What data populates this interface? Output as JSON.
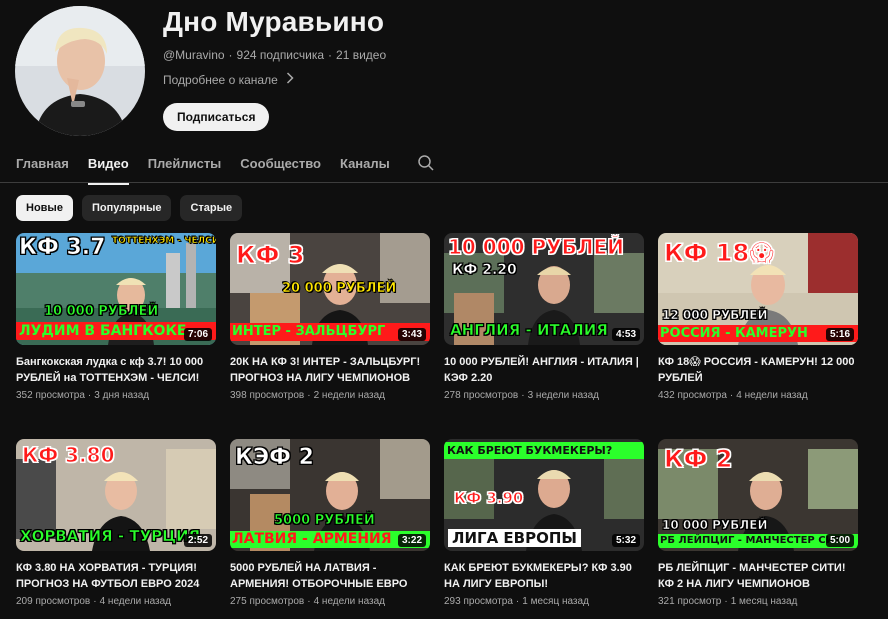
{
  "channel": {
    "name": "Дно Муравьино",
    "handle": "@Muravino",
    "subscribers": "924 подписчика",
    "videos_count": "21 видео",
    "more_about": "Подробнее о канале",
    "subscribe_label": "Подписаться"
  },
  "tabs": [
    "Главная",
    "Видео",
    "Плейлисты",
    "Сообщество",
    "Каналы"
  ],
  "active_tab": "Видео",
  "filters": [
    "Новые",
    "Популярные",
    "Старые"
  ],
  "active_filter": "Новые",
  "colors": {
    "background": "#0f0f0f",
    "text": "#f1f1f1",
    "secondary_text": "#aaaaaa",
    "chip": "#272727"
  },
  "videos": [
    {
      "title": "Бангкокская лудка с кф 3.7! 10 000 РУБЛЕЙ на ТОТТЕНХЭМ - ЧЕЛСИ!",
      "views": "352 просмотра",
      "date": "3 дня назад",
      "duration": "7:06",
      "overlay": {
        "top": "КФ 3.7",
        "tag": "ТОТТЕНХЭМ - ЧЕЛСИ",
        "amount": "10 000 РУБЛЕЙ",
        "bottom": "ЛУДИМ В БАНГКОКЕ"
      }
    },
    {
      "title": "20К НА КФ 3! ИНТЕР - ЗАЛЬЦБУРГ! ПРОГНОЗ НА ЛИГУ ЧЕМПИОНОВ",
      "views": "398 просмотров",
      "date": "2 недели назад",
      "duration": "3:43",
      "overlay": {
        "top": "КФ 3",
        "amount": "20 000 РУБЛЕЙ",
        "bottom": "ИНТЕР - ЗАЛЬЦБУРГ"
      }
    },
    {
      "title": "10 000 РУБЛЕЙ! АНГЛИЯ - ИТАЛИЯ | КЭФ 2.20",
      "views": "278 просмотров",
      "date": "3 недели назад",
      "duration": "4:53",
      "overlay": {
        "top": "10 000 РУБЛЕЙ",
        "tag": "КФ 2.20",
        "bottom": "АНГЛИЯ - ИТАЛИЯ"
      }
    },
    {
      "title": "КФ 18😱 РОССИЯ - КАМЕРУН! 12 000 РУБЛЕЙ",
      "views": "432 просмотра",
      "date": "4 недели назад",
      "duration": "5:16",
      "overlay": {
        "top": "КФ 18😱",
        "amount": "12 000 РУБЛЕЙ",
        "bottom": "РОССИЯ - КАМЕРУН"
      }
    },
    {
      "title": "КФ 3.80 НА ХОРВАТИЯ - ТУРЦИЯ! ПРОГНОЗ НА ФУТБОЛ ЕВРО 2024",
      "views": "209 просмотров",
      "date": "4 недели назад",
      "duration": "2:52",
      "overlay": {
        "top": "КФ 3.80",
        "bottom": "ХОРВАТИЯ - ТУРЦИЯ"
      }
    },
    {
      "title": "5000 РУБЛЕЙ НА ЛАТВИЯ - АРМЕНИЯ! ОТБОРОЧНЫЕ ЕВРО 2024",
      "views": "275 просмотров",
      "date": "4 недели назад",
      "duration": "3:22",
      "overlay": {
        "top": "КЭФ 2",
        "amount": "5000 РУБЛЕЙ",
        "bottom": "ЛАТВИЯ - АРМЕНИЯ"
      }
    },
    {
      "title": "КАК БРЕЮТ БУКМЕКЕРЫ? КФ 3.90 НА ЛИГУ ЕВРОПЫ!",
      "views": "293 просмотра",
      "date": "1 месяц назад",
      "duration": "5:32",
      "overlay": {
        "top": "КАК БРЕЮТ БУКМЕКЕРЫ?",
        "tag": "КФ 3.90",
        "bottom": "ЛИГА ЕВРОПЫ"
      }
    },
    {
      "title": "РБ ЛЕЙПЦИГ - МАНЧЕСТЕР СИТИ! КФ 2 НА ЛИГУ ЧЕМПИОНОВ",
      "views": "321 просмотр",
      "date": "1 месяц назад",
      "duration": "5:00",
      "overlay": {
        "top": "КФ 2",
        "amount": "10 000 РУБЛЕЙ",
        "bottom": "РБ ЛЕЙПЦИГ - МАНЧЕСТЕР СИТИ"
      }
    }
  ]
}
